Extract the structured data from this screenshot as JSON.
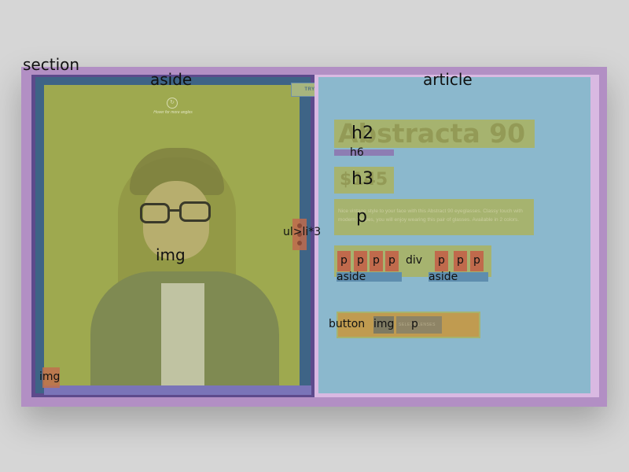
{
  "labels": {
    "section": "section",
    "aside": "aside",
    "article": "article",
    "img_main": "img",
    "img_thumb": "img",
    "ul": "ul>li*3",
    "h2": "h2",
    "h6": "h6",
    "h3": "h3",
    "p": "p",
    "div": "div",
    "swatch_p": "p",
    "aside_a": "aside",
    "aside_b": "aside",
    "button": "button",
    "button_img": "img",
    "button_p": "p"
  },
  "product": {
    "hint_text": "Hover for more angles",
    "try_on": "TRY ON",
    "title": "Abstracta 90",
    "price": "$145",
    "description": "Nice vintage style to your face with this Abstract 90 eyeglasses. Classy touch with modern shapes, you will enjoy wearing this pair of glasses. Available in 2 colors.",
    "select_label": "SELECT LENSES"
  },
  "colors": {
    "section": "#b28fc4",
    "aside": "#5d4a8c",
    "article": "#d9b9e2",
    "highlight": "#a6b36f",
    "swatch": "#c06a4c",
    "button": "#c09b50"
  },
  "icons": [
    "rotate-icon",
    "list-marker-icon"
  ]
}
